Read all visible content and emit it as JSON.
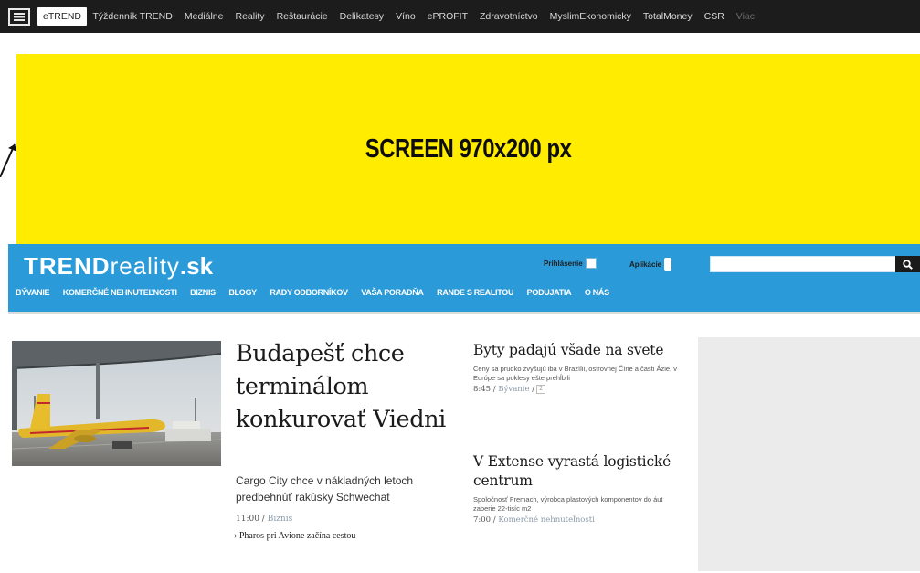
{
  "topbar": {
    "links": [
      {
        "label": "eTREND",
        "active": true
      },
      {
        "label": "Týždenník TREND"
      },
      {
        "label": "Mediálne"
      },
      {
        "label": "Reality"
      },
      {
        "label": "Reštaurácie"
      },
      {
        "label": "Delikatesy"
      },
      {
        "label": "Víno"
      },
      {
        "label": "ePROFIT"
      },
      {
        "label": "Zdravotníctvo"
      },
      {
        "label": "MyslimEkonomicky"
      },
      {
        "label": "TotalMoney"
      },
      {
        "label": "CSR"
      },
      {
        "label": "Viac"
      }
    ]
  },
  "banner": {
    "text": "SCREEN 970x200 px",
    "color": "#ffec00"
  },
  "header": {
    "brand_part1": "TREND",
    "brand_part2": "reality",
    "brand_part3": ".sk",
    "login_label": "Prihlásenie",
    "apps_label": "Aplikácie",
    "search_placeholder": "",
    "accent_color": "#2a9ad8",
    "nav": [
      "Bývanie",
      "Komerčné nehnuteľnosti",
      "Biznis",
      "Blogy",
      "Rady odborníkov",
      "Vaša poradňa",
      "Rande s realitou",
      "Podujatia",
      "O nás"
    ]
  },
  "lead": {
    "title": "Budapešť chce terminálom konkurovať Viedni",
    "text": "Cargo City chce v nákladných letoch predbehnúť rakúsky Schwechat",
    "time": "11:00",
    "category": "Biznis",
    "related": "Pharos pri Avione začína cestou"
  },
  "side_articles": [
    {
      "title": "Byty padajú všade na svete",
      "text": "Ceny sa prudko zvyšujú iba v Brazílii, ostrovnej Číne a časti Ázie, v Európe sa poklesy ešte prehĺbili",
      "time": "8:45",
      "category": "Bývanie",
      "badge": "2"
    },
    {
      "title": "V Extense vyrastá logistické centrum",
      "text": "Spoločnosť Fremach, výrobca plastových komponentov do áut zaberie 22-tisíc m2",
      "time": "7:00",
      "category": "Komerčné nehnuteľnosti"
    }
  ]
}
